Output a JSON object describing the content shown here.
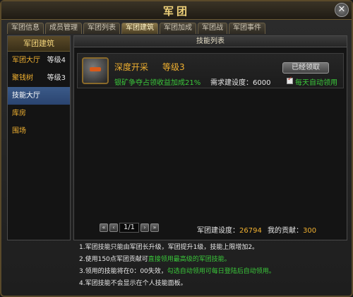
{
  "window": {
    "title": "军团"
  },
  "tabs": [
    {
      "label": "军团信息"
    },
    {
      "label": "成员管理"
    },
    {
      "label": "军团列表"
    },
    {
      "label": "军团建筑"
    },
    {
      "label": "军团加成"
    },
    {
      "label": "军团战"
    },
    {
      "label": "军团事件"
    }
  ],
  "sidebar": {
    "header": "军团建筑",
    "items": [
      {
        "label": "军团大厅",
        "level": "等级4"
      },
      {
        "label": "聚钱树",
        "level": "等级3"
      },
      {
        "label": "技能大厅",
        "level": ""
      },
      {
        "label": "库房",
        "level": ""
      },
      {
        "label": "围场",
        "level": ""
      }
    ]
  },
  "main": {
    "header": "技能列表",
    "skill": {
      "icon": "helmet-icon",
      "name": "深度开采",
      "level": "等级3",
      "description": "银矿争夺占领收益加成21%",
      "requirement": "需求建设度：6000",
      "claim_button": "已经领取",
      "auto_claim_checked": true,
      "auto_claim_label": "每天自动领用"
    },
    "pager": {
      "first": "«",
      "prev": "‹",
      "page_display": "1/1",
      "next": "›",
      "last": "»"
    },
    "stats": {
      "build_label": "军团建设度：",
      "build_value": "26794",
      "contrib_label": "我的贡献：",
      "contrib_value": "300"
    }
  },
  "notes": {
    "line1": "1.军团技能只能由军团长升级，军团提升1级，技能上限增加2。",
    "line2_prefix": "2.使用150点军团贡献可",
    "line2_green": "直接领用最高级的军团技能。",
    "line3_prefix": "3.领用的技能将在0：00失效，",
    "line3_green": "勾选自动领用可每日登陆后自动领用。",
    "line4": "4.军团技能不会显示在个人技能面板。"
  },
  "colors": {
    "accent_gold": "#f0b030",
    "title_gold": "#f0d27a",
    "green_text": "#3ac83a",
    "active_blue": "#3b5a88"
  }
}
